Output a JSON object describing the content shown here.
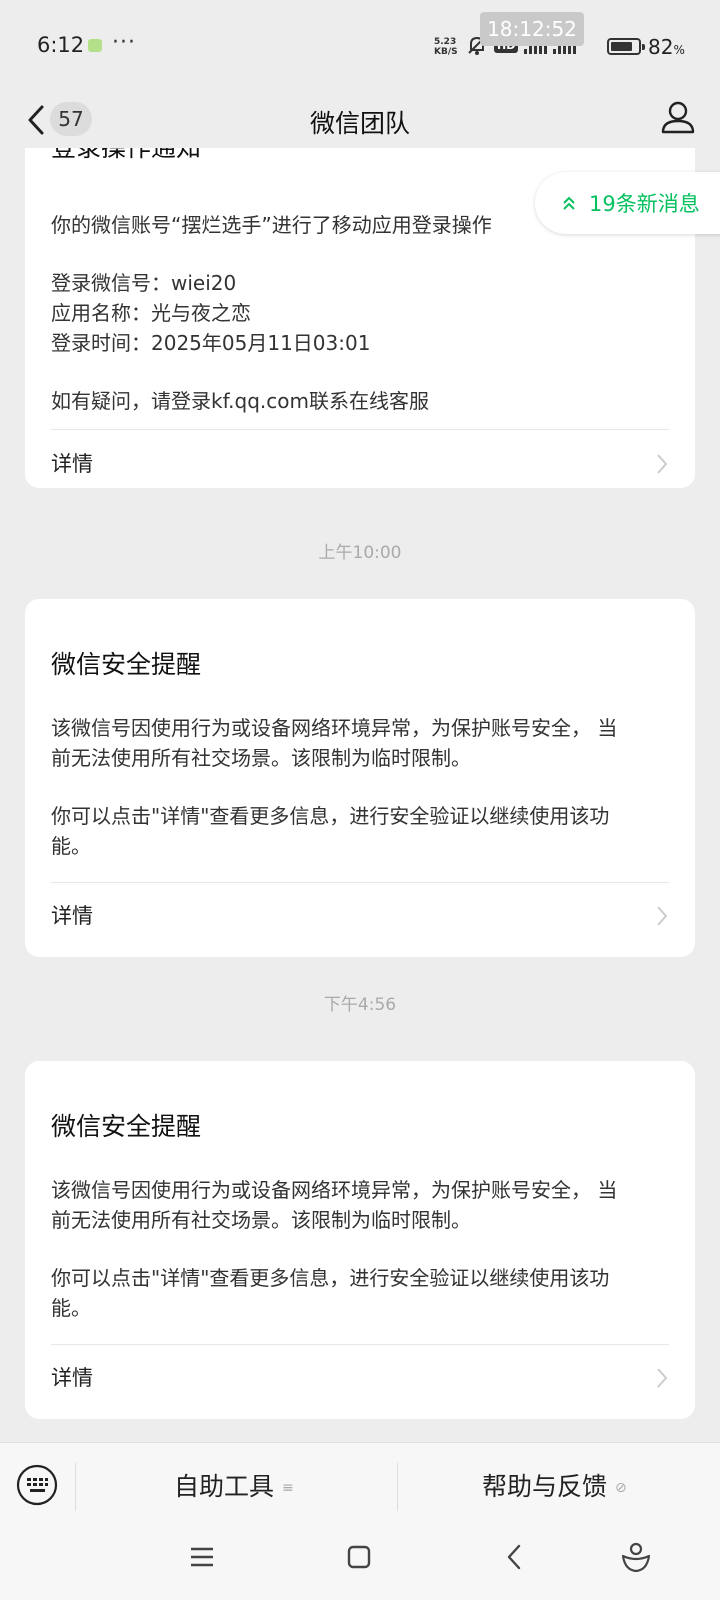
{
  "status_bar": {
    "time": "6:12",
    "more_indicator": "···",
    "clock_overlay": "18:12:52",
    "net_speed_value": "5.23",
    "net_speed_unit": "KB/S",
    "hd_label": "HD",
    "signal_label_1": "5G",
    "signal_label_2": "5G",
    "battery_percent": "82",
    "battery_unit": "%",
    "battery_level": 0.82
  },
  "nav": {
    "unread_count": "57",
    "title": "微信团队"
  },
  "new_messages_pill": {
    "label": "19条新消息",
    "accent": "#07c160"
  },
  "messages": [
    {
      "title_partial": "登录操作通知",
      "body_lines": [
        "你的微信账号“摆烂选手”进行了移动应用登录操作",
        "登录微信号：wiei20",
        "应用名称：光与夜之恋",
        "登录时间：2025年05月11日03:01",
        "如有疑问，请登录kf.qq.com联系在线客服"
      ],
      "detail_label": "详情"
    },
    {
      "timestamp": "上午10:00",
      "title": "微信安全提醒",
      "body_para_1_line_1": "该微信号因使用行为或设备网络环境异常，为保护账号安全， 当",
      "body_para_1_line_2": "前无法使用所有社交场景。该限制为临时限制。",
      "body_para_2_line_1": "你可以点击\"详情\"查看更多信息，进行安全验证以继续使用该功",
      "body_para_2_line_2": "能。",
      "detail_label": "详情"
    },
    {
      "timestamp": "下午4:56",
      "title": "微信安全提醒",
      "body_para_1_line_1": "该微信号因使用行为或设备网络环境异常，为保护账号安全， 当",
      "body_para_1_line_2": "前无法使用所有社交场景。该限制为临时限制。",
      "body_para_2_line_1": "你可以点击\"详情\"查看更多信息，进行安全验证以继续使用该功",
      "body_para_2_line_2": "能。",
      "detail_label": "详情"
    }
  ],
  "bottom_menu": {
    "items": [
      {
        "label": "自助工具",
        "icon": "list-icon",
        "glyph": "≡"
      },
      {
        "label": "帮助与反馈",
        "icon": "link-icon",
        "glyph": "⊘"
      }
    ]
  },
  "system_nav": {
    "buttons": [
      "menu-icon",
      "home-icon",
      "back-icon",
      "assistant-icon"
    ]
  }
}
